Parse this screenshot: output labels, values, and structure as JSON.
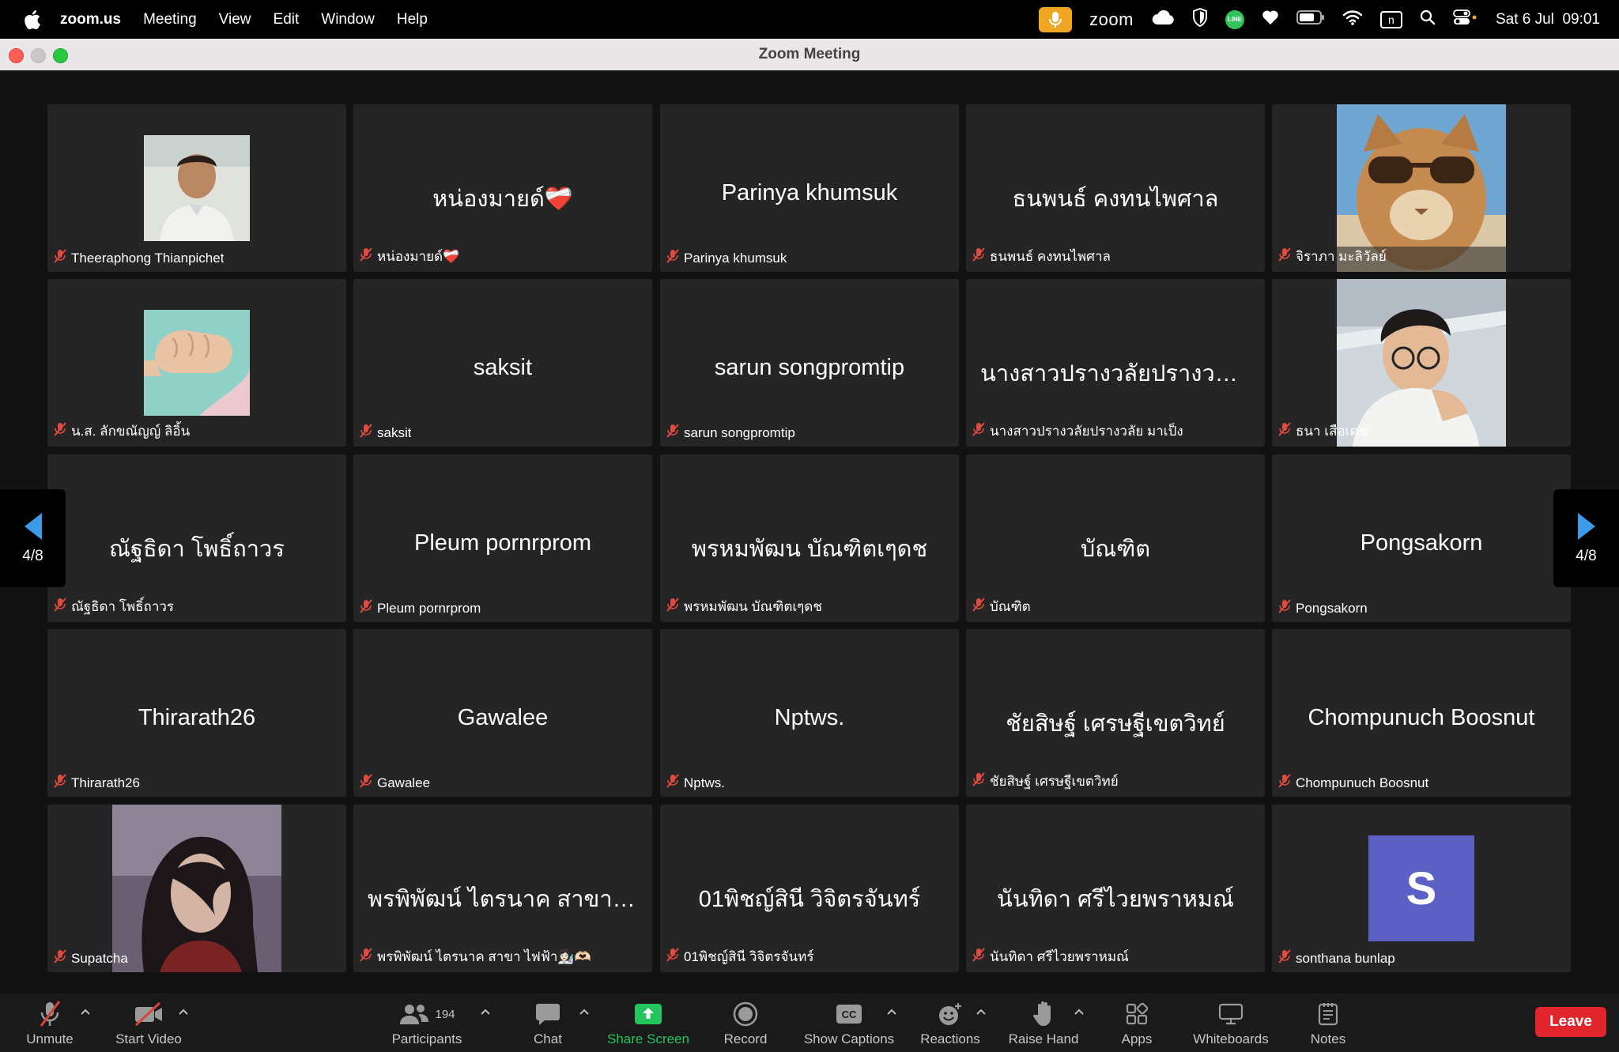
{
  "menubar": {
    "app": "zoom.us",
    "items": [
      "Meeting",
      "View",
      "Edit",
      "Window",
      "Help"
    ],
    "zoom_label": "zoom",
    "line_label": "LINE",
    "n_label": "n",
    "clock": "Sat 6 Jul  09:01"
  },
  "window": {
    "title": "Zoom Meeting"
  },
  "pager": {
    "left": "4/8",
    "right": "4/8"
  },
  "tiles": [
    {
      "center": "",
      "label": "Theeraphong Thianpichet",
      "photo": "avatar-boy"
    },
    {
      "center": "หน่องมายด์❤️‍🩹",
      "label": "หน่องมายด์❤️‍🩹"
    },
    {
      "center": "Parinya khumsuk",
      "label": "Parinya khumsuk"
    },
    {
      "center": "ธนพนธ์ คงทนไพศาล",
      "label": "ธนพนธ์ คงทนไพศาล"
    },
    {
      "center": "",
      "label": "จิราภา มะลิวัลย์",
      "photo": "avatar-cat"
    },
    {
      "center": "",
      "label": "น.ส. ลักขณัญญ์  ลิอิ้น",
      "photo": "avatar-fist"
    },
    {
      "center": "saksit",
      "label": "saksit"
    },
    {
      "center": "sarun songpromtip",
      "label": "sarun songpromtip"
    },
    {
      "center": "นางสาวปรางวลัยปรางวลัย...",
      "label": "นางสาวปรางวลัยปรางวลัย มาเป็ง"
    },
    {
      "center": "",
      "label": "ธนา เสือเดช",
      "photo": "avatar-man"
    },
    {
      "center": "ณัฐธิดา โพธิ์ถาวร",
      "label": "ณัฐธิดา โพธิ์ถาวร"
    },
    {
      "center": "Pleum pornrprom",
      "label": "Pleum pornrprom"
    },
    {
      "center": "พรหมพัฒน บัณฑิตเๆดช",
      "label": "พรหมพัฒน บัณฑิตเๆดช"
    },
    {
      "center": "บัณฑิต",
      "label": "บัณฑิต"
    },
    {
      "center": "Pongsakorn",
      "label": "Pongsakorn"
    },
    {
      "center": "Thirarath26",
      "label": "Thirarath26"
    },
    {
      "center": "Gawalee",
      "label": "Gawalee"
    },
    {
      "center": "Nptws.",
      "label": "Nptws."
    },
    {
      "center": "ชัยสิษฐ์ เศรษฐีเขตวิทย์",
      "label": "ชัยสิษฐ์ เศรษฐีเขตวิทย์"
    },
    {
      "center": "Chompunuch Boosnut",
      "label": "Chompunuch Boosnut"
    },
    {
      "center": "",
      "label": "Supatcha",
      "photo": "avatar-woman"
    },
    {
      "center": "พรพิพัฒน์ ไตรนาค สาขา ไฟ...",
      "label": "พรพิพัฒน์ ไตรนาค สาขา ไฟฟ้า👩🏻‍🔬🫶🏻"
    },
    {
      "center": "01พิชญ์สินี วิจิตรจันทร์",
      "label": "01พิชญ์สินี วิจิตรจันทร์"
    },
    {
      "center": "นันทิดา ศรีไวยพราหมณ์",
      "label": "นันทิดา ศรีไวยพราหมณ์"
    },
    {
      "center": "",
      "label": "sonthana bunlap",
      "initial": "S",
      "initial_color": "#5c5fc4"
    }
  ],
  "toolbar": {
    "unmute": "Unmute",
    "start_video": "Start Video",
    "participants": "Participants",
    "participants_count": "194",
    "chat": "Chat",
    "share_screen": "Share Screen",
    "record": "Record",
    "show_captions": "Show Captions",
    "cc": "CC",
    "reactions": "Reactions",
    "raise_hand": "Raise Hand",
    "apps": "Apps",
    "whiteboards": "Whiteboards",
    "notes": "Notes",
    "leave": "Leave"
  },
  "colors": {
    "share_green": "#22c55e",
    "leave_red": "#e0252c",
    "mute_red": "#d9443a",
    "arrow_blue": "#3d9be9"
  }
}
